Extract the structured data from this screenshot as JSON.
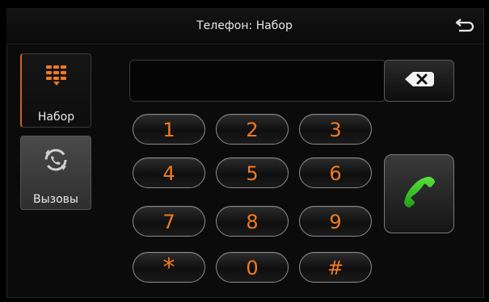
{
  "header": {
    "title": "Телефон: Набор",
    "back_icon": "back-arrow-icon"
  },
  "sidebar": {
    "items": [
      {
        "label": "Набор",
        "icon": "dialpad-icon",
        "active": true
      },
      {
        "label": "Вызовы",
        "icon": "call-log-icon",
        "active": false
      }
    ]
  },
  "dialer": {
    "display_value": "",
    "backspace_icon": "backspace-icon",
    "keys": [
      "1",
      "2",
      "3",
      "4",
      "5",
      "6",
      "7",
      "8",
      "9",
      "*",
      "0",
      "#"
    ],
    "call_icon": "call-icon"
  },
  "colors": {
    "accent": "#f07a21",
    "call_green": "#2bc21f"
  }
}
